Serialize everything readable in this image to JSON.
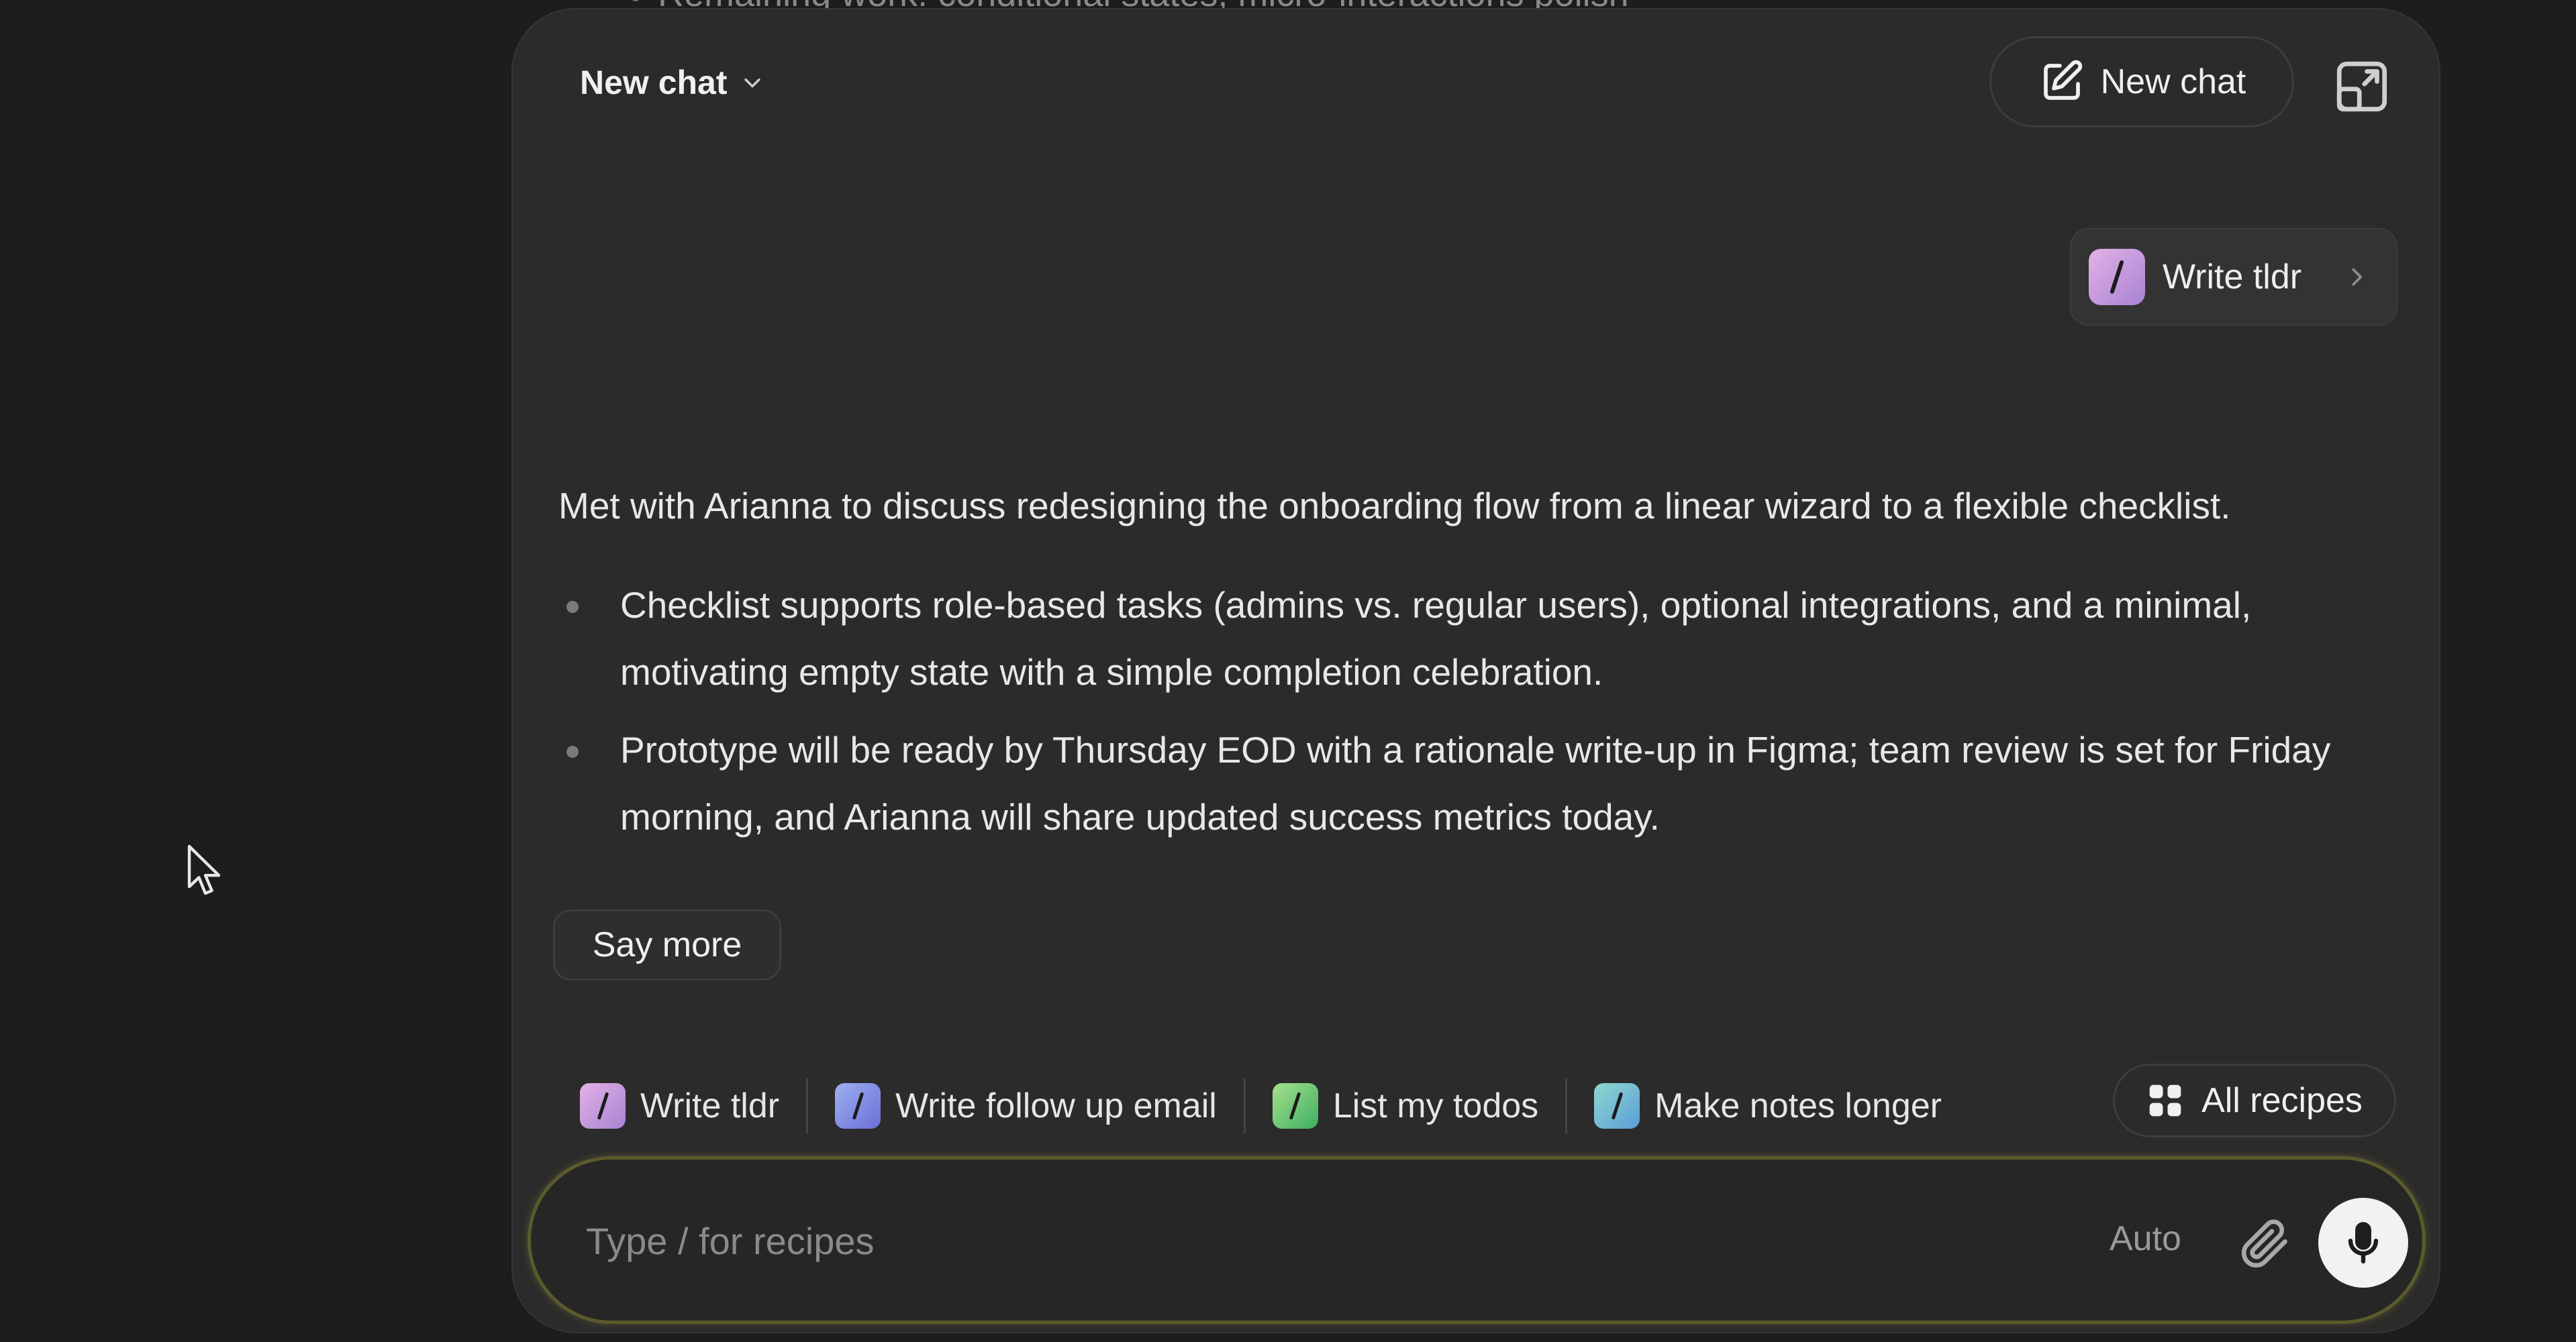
{
  "background_peek": {
    "text": "Remaining work: conditional states, micro-interactions polish"
  },
  "header": {
    "title": "New chat",
    "title_icon": "chevron-down-icon",
    "new_chat_button": "New chat",
    "new_chat_icon": "compose-icon",
    "expand_icon": "expand-window-icon"
  },
  "user_recipe_chip": {
    "label": "Write tldr",
    "color": "#c38fd0"
  },
  "response": {
    "summary": "Met with Arianna to discuss redesigning the onboarding flow from a linear wizard to a flexible checklist.",
    "bullets": [
      "Checklist supports role-based tasks (admins vs. regular users), optional integrations, and a minimal, motivating empty state with a simple completion celebration.",
      "Prototype will be ready by Thursday EOD with a rationale write-up in Figma; team review is set for Friday morning, and Arianna will share updated success metrics today."
    ]
  },
  "say_more_button": "Say more",
  "recipes": [
    {
      "label": "Write tldr",
      "color": "#c38fd0"
    },
    {
      "label": "Write follow up email",
      "color": "#7b8ee0"
    },
    {
      "label": "List my todos",
      "color": "#6cc27a"
    },
    {
      "label": "Make notes longer",
      "color": "#62b8c0"
    }
  ],
  "all_recipes_button": "All recipes",
  "composer": {
    "placeholder": "Type / for recipes",
    "mode": "Auto",
    "attach_icon": "paperclip-icon",
    "mic_icon": "microphone-icon"
  },
  "colors": {
    "panel_bg": "#2b2b2b",
    "page_bg": "#1d1d1d",
    "composer_border": "#5a5a2c",
    "mic_button_bg": "#f2f2f2"
  }
}
